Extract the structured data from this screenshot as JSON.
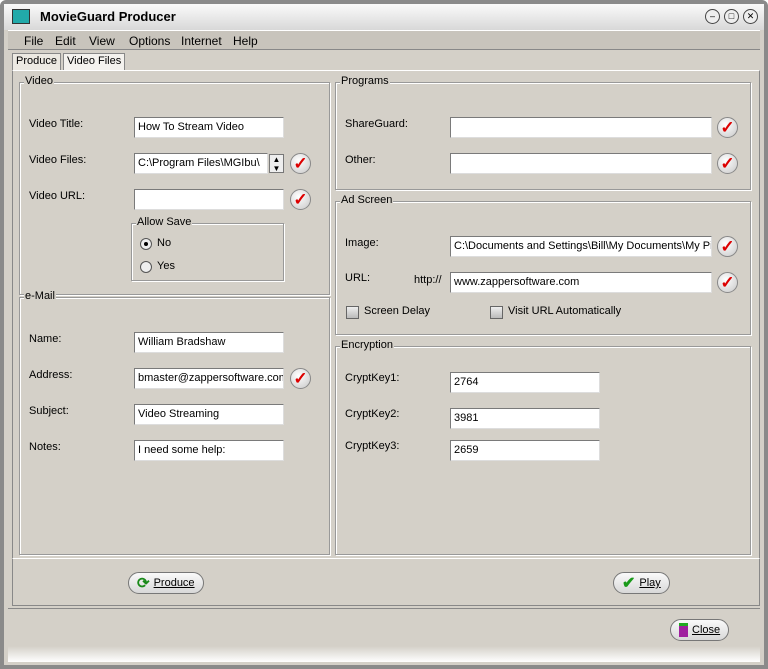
{
  "window": {
    "title": "MovieGuard Producer"
  },
  "menu": [
    "File",
    "Edit",
    "View",
    "Options",
    "Internet",
    "Help"
  ],
  "tabs": [
    "Produce",
    "Video Files"
  ],
  "video": {
    "group": "Video",
    "title_label": "Video Title:",
    "title_value": "How To Stream Video",
    "files_label": "Video Files:",
    "files_value": "C:\\Program Files\\MGIbu\\",
    "url_label": "Video URL:",
    "url_value": "",
    "allow_save": "Allow Save",
    "no": "No",
    "yes": "Yes"
  },
  "email": {
    "group": "e-Mail",
    "name_label": "Name:",
    "name_value": "William Bradshaw",
    "address_label": "Address:",
    "address_value": "bmaster@zappersoftware.com",
    "subject_label": "Subject:",
    "subject_value": "Video Streaming",
    "notes_label": "Notes:",
    "notes_value": "I need some help:"
  },
  "programs": {
    "group": "Programs",
    "shareguard_label": "ShareGuard:",
    "shareguard_value": "",
    "other_label": "Other:",
    "other_value": ""
  },
  "ad": {
    "group": "Ad Screen",
    "image_label": "Image:",
    "image_value": "C:\\Documents and Settings\\Bill\\My Documents\\My Pi",
    "url_label": "URL:",
    "url_prefix": "http://",
    "url_value": "www.zappersoftware.com",
    "screen_delay": "Screen Delay",
    "visit_url": "Visit URL Automatically"
  },
  "encryption": {
    "group": "Encryption",
    "key1_label": "CryptKey1:",
    "key1": "2764",
    "key2_label": "CryptKey2:",
    "key2": "3981",
    "key3_label": "CryptKey3:",
    "key3": "2659"
  },
  "buttons": {
    "produce": "Produce",
    "play": "Play",
    "close": "Close"
  }
}
